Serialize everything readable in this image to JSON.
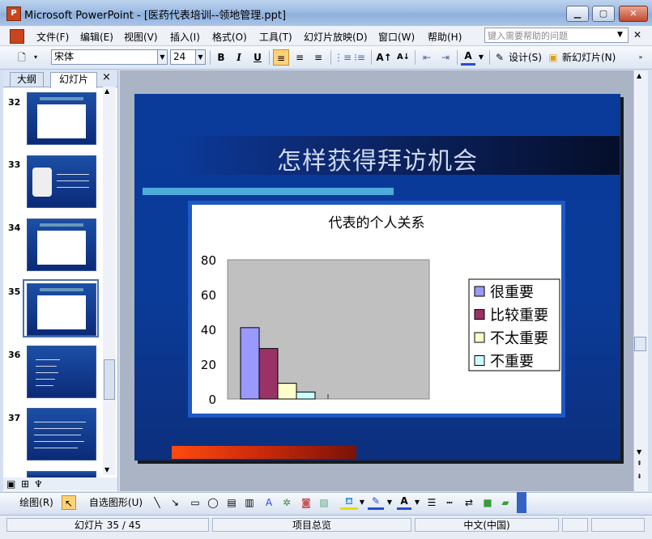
{
  "window": {
    "title": "Microsoft PowerPoint - [医药代表培训--领地管理.ppt]"
  },
  "menu": {
    "items": [
      "文件(F)",
      "编辑(E)",
      "视图(V)",
      "插入(I)",
      "格式(O)",
      "工具(T)",
      "幻灯片放映(D)",
      "窗口(W)",
      "帮助(H)"
    ],
    "help_placeholder": "键入需要帮助的问题"
  },
  "toolbar": {
    "font_name": "宋体",
    "font_size": "24",
    "bold": "B",
    "italic": "I",
    "underline": "U",
    "design_label": "设计(S)",
    "new_slide_label": "新幻灯片(N)",
    "font_color_glyph": "A"
  },
  "pane": {
    "tab_outline": "大纲",
    "tab_slides": "幻灯片",
    "close": "×",
    "thumbnails": [
      {
        "num": "32"
      },
      {
        "num": "33"
      },
      {
        "num": "34"
      },
      {
        "num": "35"
      },
      {
        "num": "36"
      },
      {
        "num": "37"
      }
    ]
  },
  "slide": {
    "title": "怎样获得拜访机会"
  },
  "chart_data": {
    "type": "bar",
    "title": "代表的个人关系",
    "categories": [
      ""
    ],
    "series": [
      {
        "name": "很重要",
        "values": [
          41
        ],
        "color": "#9a99ff"
      },
      {
        "name": "比较重要",
        "values": [
          29
        ],
        "color": "#993366"
      },
      {
        "name": "不太重要",
        "values": [
          9
        ],
        "color": "#ffffcc"
      },
      {
        "name": "不重要",
        "values": [
          4
        ],
        "color": "#ccffff"
      }
    ],
    "yticks": [
      "0",
      "20",
      "40",
      "60",
      "80"
    ],
    "ylim": [
      0,
      80
    ],
    "grid": false,
    "legend": "right",
    "plot_background": "#c0c0c0"
  },
  "drawing_toolbar": {
    "draw_label": "绘图(R)",
    "autoshape_label": "自选图形(U)"
  },
  "status": {
    "slide_info": "幻灯片 35 / 45",
    "design": "项目总览",
    "language": "中文(中国)"
  }
}
